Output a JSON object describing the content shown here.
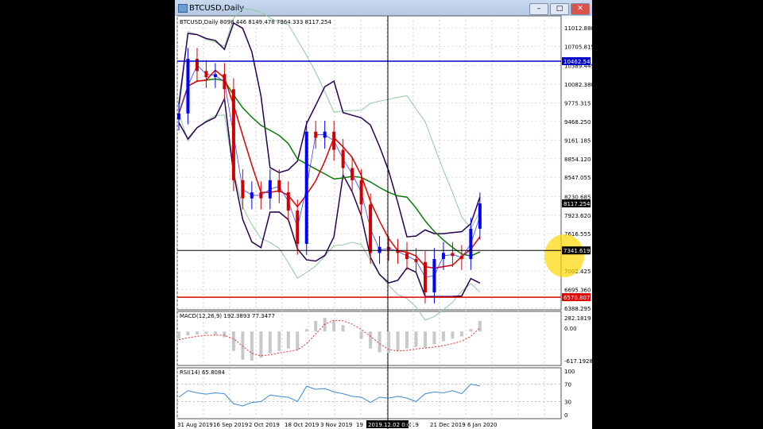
{
  "window": {
    "title": "BTCUSD,Daily",
    "minimize": "–",
    "maximize": "□",
    "close": "✕"
  },
  "main": {
    "legend": "BTCUSD,Daily  8098.446 8149.478 7964.333 8117.254",
    "price_ticks": [
      "11012.880",
      "10705.815",
      "10389.445",
      "10082.380",
      "9775.315",
      "9468.250",
      "9161.185",
      "8854.120",
      "8547.055",
      "8230.685",
      "7923.620",
      "7616.555",
      "7002.425",
      "6695.360",
      "6388.295"
    ],
    "labels": {
      "blue_line": "10462.549",
      "current": "8117.254",
      "crosshair": "7341.619",
      "red_line": "6570.807"
    },
    "colors": {
      "blue_line": "#0000c8",
      "red_line": "#e00000",
      "bull": "#0000ff",
      "bear": "#d00000"
    }
  },
  "macd": {
    "legend": "MACD(12,26,9) 192.3893 77.3477",
    "ticks": [
      "282.1819",
      "0.00",
      "-617.1928"
    ]
  },
  "rsi": {
    "legend": "RSI(14) 65.8084",
    "ticks": [
      "100",
      "70",
      "30",
      "0"
    ]
  },
  "dates": [
    "31 Aug 2019",
    "16 Sep 2019",
    "2 Oct 2019",
    "18 Oct 2019",
    "3 Nov 2019",
    "19",
    "2019",
    "21 Dec 2019",
    "6 Jan 2020"
  ],
  "crosshair_date": "2019.12.02 0:00",
  "chart_data": {
    "type": "candlestick",
    "symbol": "BTCUSD",
    "timeframe": "Daily",
    "ylim": [
      6388.295,
      11012.88
    ],
    "step_days": 4,
    "closes": [
      9600,
      10500,
      10300,
      10200,
      10250,
      10000,
      8500,
      8200,
      8300,
      8200,
      8500,
      8300,
      8000,
      7450,
      9300,
      9200,
      9300,
      9000,
      8700,
      8500,
      8100,
      7300,
      7400,
      7350,
      7300,
      7200,
      7150,
      6650,
      7200,
      7300,
      7250,
      7200,
      7700,
      8117
    ],
    "macd": [
      -150,
      -80,
      -60,
      -50,
      -70,
      -120,
      -400,
      -580,
      -600,
      -540,
      -450,
      -400,
      -350,
      -380,
      50,
      220,
      280,
      230,
      130,
      0,
      -150,
      -350,
      -430,
      -440,
      -400,
      -350,
      -320,
      -330,
      -260,
      -200,
      -150,
      -100,
      50,
      220
    ],
    "signal": [
      -170,
      -130,
      -100,
      -80,
      -75,
      -80,
      -150,
      -300,
      -450,
      -500,
      -480,
      -440,
      -410,
      -380,
      -250,
      -50,
      150,
      230,
      220,
      150,
      40,
      -100,
      -250,
      -370,
      -400,
      -390,
      -360,
      -340,
      -320,
      -290,
      -250,
      -200,
      -100,
      77
    ],
    "rsi": [
      40,
      55,
      50,
      47,
      50,
      48,
      25,
      20,
      28,
      30,
      45,
      42,
      40,
      30,
      65,
      58,
      60,
      52,
      48,
      42,
      40,
      28,
      40,
      38,
      42,
      38,
      30,
      48,
      52,
      50,
      55,
      48,
      70,
      66
    ]
  }
}
